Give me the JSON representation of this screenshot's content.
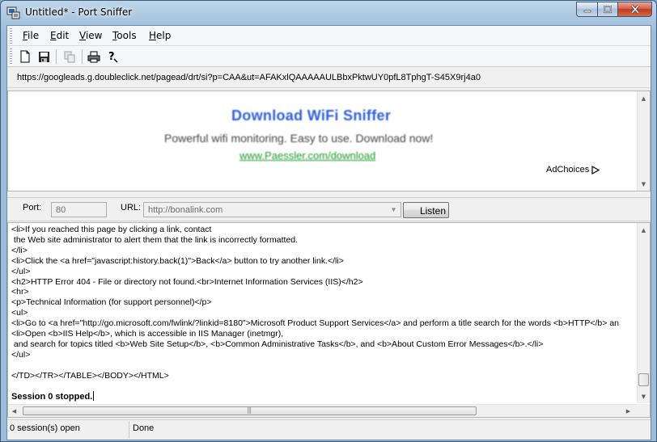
{
  "window": {
    "title": "Untitled* - Port Sniffer"
  },
  "menu": [
    "File",
    "Edit",
    "View",
    "Tools",
    "Help"
  ],
  "toolbar": {
    "icons": [
      "new-file-icon",
      "save-icon",
      "copy-icon",
      "print-icon",
      "help-icon"
    ]
  },
  "address": {
    "url": "https://googleads.g.doubleclick.net/pagead/drt/si?p=CAA&ut=AFAKxlQAAAAAULBbxPktwUY0pfL8TphgT-S45X9rj4a0"
  },
  "ad": {
    "title": "Download WiFi Sniffer",
    "description": "Powerful wifi monitoring. Easy to use. Download now!",
    "link": "www.Paessler.com/download",
    "choices": "AdChoices"
  },
  "controls": {
    "port_label": "Port:",
    "port_value": "80",
    "url_label": "URL:",
    "url_value": "http://bonalink.com",
    "listen_label": "Listen"
  },
  "log": {
    "lines": [
      "<li>If you reached this page by clicking a link, contact",
      " the Web site administrator to alert them that the link is incorrectly formatted.",
      "</li>",
      "<li>Click the <a href=\"javascript:history.back(1)\">Back</a> button to try another link.</li>",
      "</ul>",
      "<h2>HTTP Error 404 - File or directory not found.<br>Internet Information Services (IIS)</h2>",
      "<hr>",
      "<p>Technical Information (for support personnel)</p>",
      "<ul>",
      "<li>Go to <a href=\"http://go.microsoft.com/fwlink/?linkid=8180\">Microsoft Product Support Services</a> and perform a title search for the words <b>HTTP</b> an",
      "<li>Open <b>IIS Help</b>, which is accessible in IIS Manager (inetmgr),",
      " and search for topics titled <b>Web Site Setup</b>, <b>Common Administrative Tasks</b>, and <b>About Custom Error Messages</b>.</li>",
      "</ul>",
      "",
      "</TD></TR></TABLE></BODY></HTML>"
    ],
    "status": "Session 0 stopped."
  },
  "statusbar": {
    "sessions": "0 session(s) open",
    "state": "Done"
  },
  "colors": {
    "ad_title": "#2f5fd6",
    "ad_link": "#1a9a2a",
    "close_button": "#c2391e"
  }
}
